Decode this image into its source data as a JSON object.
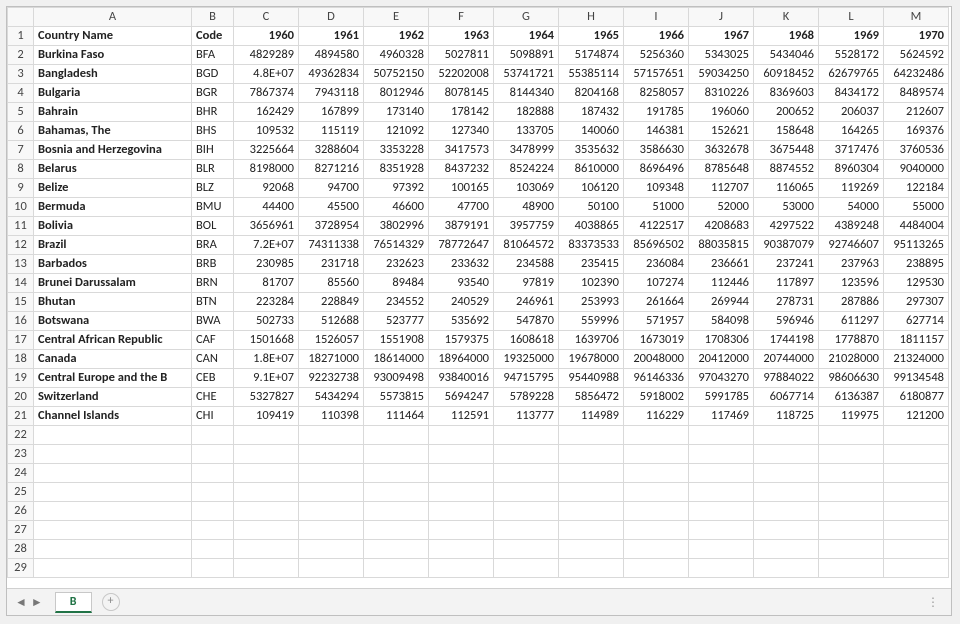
{
  "sheet": {
    "active_tab": "B"
  },
  "columns": [
    "A",
    "B",
    "C",
    "D",
    "E",
    "F",
    "G",
    "H",
    "I",
    "J",
    "K",
    "L",
    "M"
  ],
  "header_row": {
    "A": "Country Name",
    "B": "Code",
    "years": [
      "1960",
      "1961",
      "1962",
      "1963",
      "1964",
      "1965",
      "1966",
      "1967",
      "1968",
      "1969",
      "1970"
    ]
  },
  "rows": [
    {
      "name": "Burkina Faso",
      "code": "BFA",
      "v": [
        "4829289",
        "4894580",
        "4960328",
        "5027811",
        "5098891",
        "5174874",
        "5256360",
        "5343025",
        "5434046",
        "5528172",
        "5624592"
      ]
    },
    {
      "name": "Bangladesh",
      "code": "BGD",
      "v": [
        "4.8E+07",
        "49362834",
        "50752150",
        "52202008",
        "53741721",
        "55385114",
        "57157651",
        "59034250",
        "60918452",
        "62679765",
        "64232486"
      ]
    },
    {
      "name": "Bulgaria",
      "code": "BGR",
      "v": [
        "7867374",
        "7943118",
        "8012946",
        "8078145",
        "8144340",
        "8204168",
        "8258057",
        "8310226",
        "8369603",
        "8434172",
        "8489574"
      ]
    },
    {
      "name": "Bahrain",
      "code": "BHR",
      "v": [
        "162429",
        "167899",
        "173140",
        "178142",
        "182888",
        "187432",
        "191785",
        "196060",
        "200652",
        "206037",
        "212607"
      ]
    },
    {
      "name": "Bahamas, The",
      "code": "BHS",
      "v": [
        "109532",
        "115119",
        "121092",
        "127340",
        "133705",
        "140060",
        "146381",
        "152621",
        "158648",
        "164265",
        "169376"
      ]
    },
    {
      "name": "Bosnia and Herzegovina",
      "code": "BIH",
      "v": [
        "3225664",
        "3288604",
        "3353228",
        "3417573",
        "3478999",
        "3535632",
        "3586630",
        "3632678",
        "3675448",
        "3717476",
        "3760536"
      ]
    },
    {
      "name": "Belarus",
      "code": "BLR",
      "v": [
        "8198000",
        "8271216",
        "8351928",
        "8437232",
        "8524224",
        "8610000",
        "8696496",
        "8785648",
        "8874552",
        "8960304",
        "9040000"
      ]
    },
    {
      "name": "Belize",
      "code": "BLZ",
      "v": [
        "92068",
        "94700",
        "97392",
        "100165",
        "103069",
        "106120",
        "109348",
        "112707",
        "116065",
        "119269",
        "122184"
      ]
    },
    {
      "name": "Bermuda",
      "code": "BMU",
      "v": [
        "44400",
        "45500",
        "46600",
        "47700",
        "48900",
        "50100",
        "51000",
        "52000",
        "53000",
        "54000",
        "55000"
      ]
    },
    {
      "name": "Bolivia",
      "code": "BOL",
      "v": [
        "3656961",
        "3728954",
        "3802996",
        "3879191",
        "3957759",
        "4038865",
        "4122517",
        "4208683",
        "4297522",
        "4389248",
        "4484004"
      ]
    },
    {
      "name": "Brazil",
      "code": "BRA",
      "v": [
        "7.2E+07",
        "74311338",
        "76514329",
        "78772647",
        "81064572",
        "83373533",
        "85696502",
        "88035815",
        "90387079",
        "92746607",
        "95113265"
      ]
    },
    {
      "name": "Barbados",
      "code": "BRB",
      "v": [
        "230985",
        "231718",
        "232623",
        "233632",
        "234588",
        "235415",
        "236084",
        "236661",
        "237241",
        "237963",
        "238895"
      ]
    },
    {
      "name": "Brunei Darussalam",
      "code": "BRN",
      "v": [
        "81707",
        "85560",
        "89484",
        "93540",
        "97819",
        "102390",
        "107274",
        "112446",
        "117897",
        "123596",
        "129530"
      ]
    },
    {
      "name": "Bhutan",
      "code": "BTN",
      "v": [
        "223284",
        "228849",
        "234552",
        "240529",
        "246961",
        "253993",
        "261664",
        "269944",
        "278731",
        "287886",
        "297307"
      ]
    },
    {
      "name": "Botswana",
      "code": "BWA",
      "v": [
        "502733",
        "512688",
        "523777",
        "535692",
        "547870",
        "559996",
        "571957",
        "584098",
        "596946",
        "611297",
        "627714"
      ]
    },
    {
      "name": "Central African Republic",
      "code": "CAF",
      "v": [
        "1501668",
        "1526057",
        "1551908",
        "1579375",
        "1608618",
        "1639706",
        "1673019",
        "1708306",
        "1744198",
        "1778870",
        "1811157"
      ]
    },
    {
      "name": "Canada",
      "code": "CAN",
      "v": [
        "1.8E+07",
        "18271000",
        "18614000",
        "18964000",
        "19325000",
        "19678000",
        "20048000",
        "20412000",
        "20744000",
        "21028000",
        "21324000"
      ]
    },
    {
      "name": "Central Europe and the B",
      "code": "CEB",
      "v": [
        "9.1E+07",
        "92232738",
        "93009498",
        "93840016",
        "94715795",
        "95440988",
        "96146336",
        "97043270",
        "97884022",
        "98606630",
        "99134548"
      ]
    },
    {
      "name": "Switzerland",
      "code": "CHE",
      "v": [
        "5327827",
        "5434294",
        "5573815",
        "5694247",
        "5789228",
        "5856472",
        "5918002",
        "5991785",
        "6067714",
        "6136387",
        "6180877"
      ]
    },
    {
      "name": "Channel Islands",
      "code": "CHI",
      "v": [
        "109419",
        "110398",
        "111464",
        "112591",
        "113777",
        "114989",
        "116229",
        "117469",
        "118725",
        "119975",
        "121200"
      ]
    }
  ],
  "empty_rows": [
    22,
    23,
    24,
    25,
    26,
    27,
    28,
    29
  ]
}
